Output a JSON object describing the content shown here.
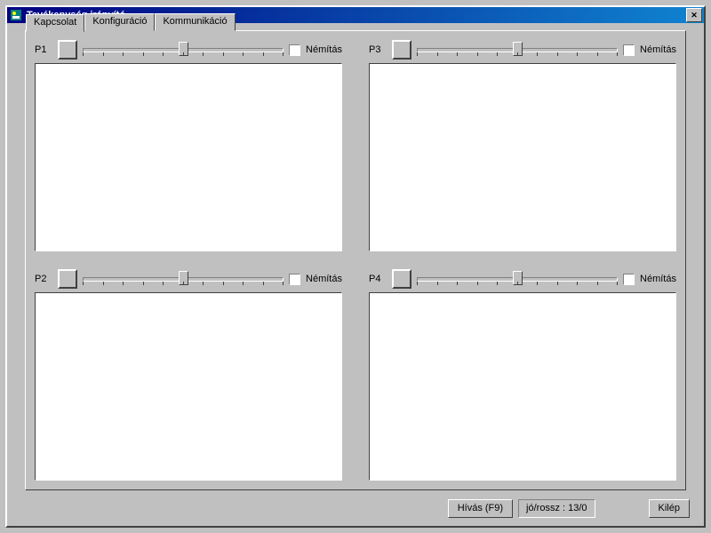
{
  "window": {
    "title": "Tevékenység irányító"
  },
  "bottom": {
    "call_button": "Hívás (F9)",
    "status": "jó/rossz : 13/0",
    "exit_button": "Kilép"
  },
  "tabs": [
    {
      "label": "Kapcsolat",
      "hotkey": "K",
      "active": true
    },
    {
      "label": "Konfiguráció",
      "hotkey": "o",
      "active": false
    },
    {
      "label": "Kommunikáció",
      "hotkey": "m",
      "active": false
    }
  ],
  "panes": [
    {
      "label": "P1",
      "mute_label": "Némítás"
    },
    {
      "label": "P2",
      "mute_label": "Némítás"
    },
    {
      "label": "P3",
      "mute_label": "Némítás"
    },
    {
      "label": "P4",
      "mute_label": "Némítás"
    }
  ]
}
